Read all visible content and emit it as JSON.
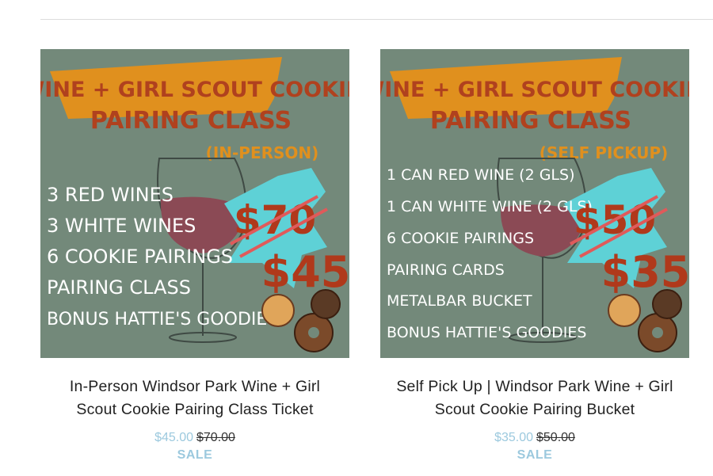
{
  "products": [
    {
      "banner_line1": "WINE + GIRL SCOUT COOKIE",
      "banner_line2": "PAIRING CLASS",
      "banner_sub": "(IN-PERSON)",
      "list": [
        "3 RED WINES",
        "3 WHITE WINES",
        "6 COOKIE PAIRINGS",
        "PAIRING CLASS",
        "BONUS HATTIE'S GOODIES"
      ],
      "old_price_art": "$70",
      "new_price_art": "$45",
      "title_line1": "In-Person Windsor Park Wine + Girl",
      "title_line2": "Scout Cookie Pairing Class Ticket",
      "sale_price": "$45.00",
      "original_price": "$70.00",
      "badge": "SALE"
    },
    {
      "banner_line1": "WINE + GIRL SCOUT COOKIE",
      "banner_line2": "PAIRING CLASS",
      "banner_sub": "(SELF PICKUP)",
      "list": [
        "1 CAN RED WINE (2 GLS)",
        "1 CAN WHITE WINE (2 GLS)",
        "6 COOKIE PAIRINGS",
        "PAIRING CARDS",
        "METALBAR BUCKET",
        "BONUS HATTIE'S GOODIES"
      ],
      "old_price_art": "$50",
      "new_price_art": "$35",
      "title_line1": "Self Pick Up | Windsor Park Wine + Girl",
      "title_line2": "Scout Cookie Pairing Bucket",
      "sale_price": "$35.00",
      "original_price": "$50.00",
      "badge": "SALE"
    }
  ],
  "colors": {
    "image_bg": "#73897a",
    "banner_orange": "#e0901e",
    "banner_text": "#b0411e",
    "list_text": "#ffffff",
    "burst_teal": "#5ed1d6",
    "price_red": "#b0391b",
    "sale_blue": "#9cc9de"
  }
}
